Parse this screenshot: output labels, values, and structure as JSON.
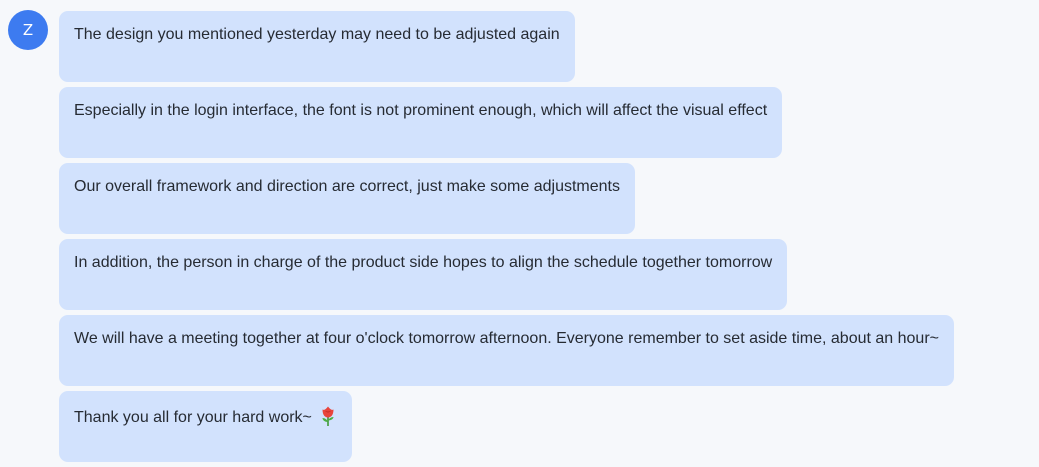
{
  "sender": {
    "avatar_initial": "Z",
    "avatar_color": "#3d7bf0"
  },
  "bubble_color": "#d2e2fd",
  "messages": [
    {
      "text": "The design you mentioned yesterday may need to be adjusted again"
    },
    {
      "text": "Especially in the login interface, the font is not prominent enough, which will affect the visual effect"
    },
    {
      "text": "Our overall framework and direction are correct, just make some adjustments"
    },
    {
      "text": "In addition, the person in charge of the product side hopes to align the schedule together tomorrow"
    },
    {
      "text": "We will have a meeting together at four o'clock tomorrow afternoon. Everyone remember to set aside time, about an hour~"
    },
    {
      "text": "Thank you all for your hard work~",
      "emoji": "rose-icon"
    }
  ]
}
